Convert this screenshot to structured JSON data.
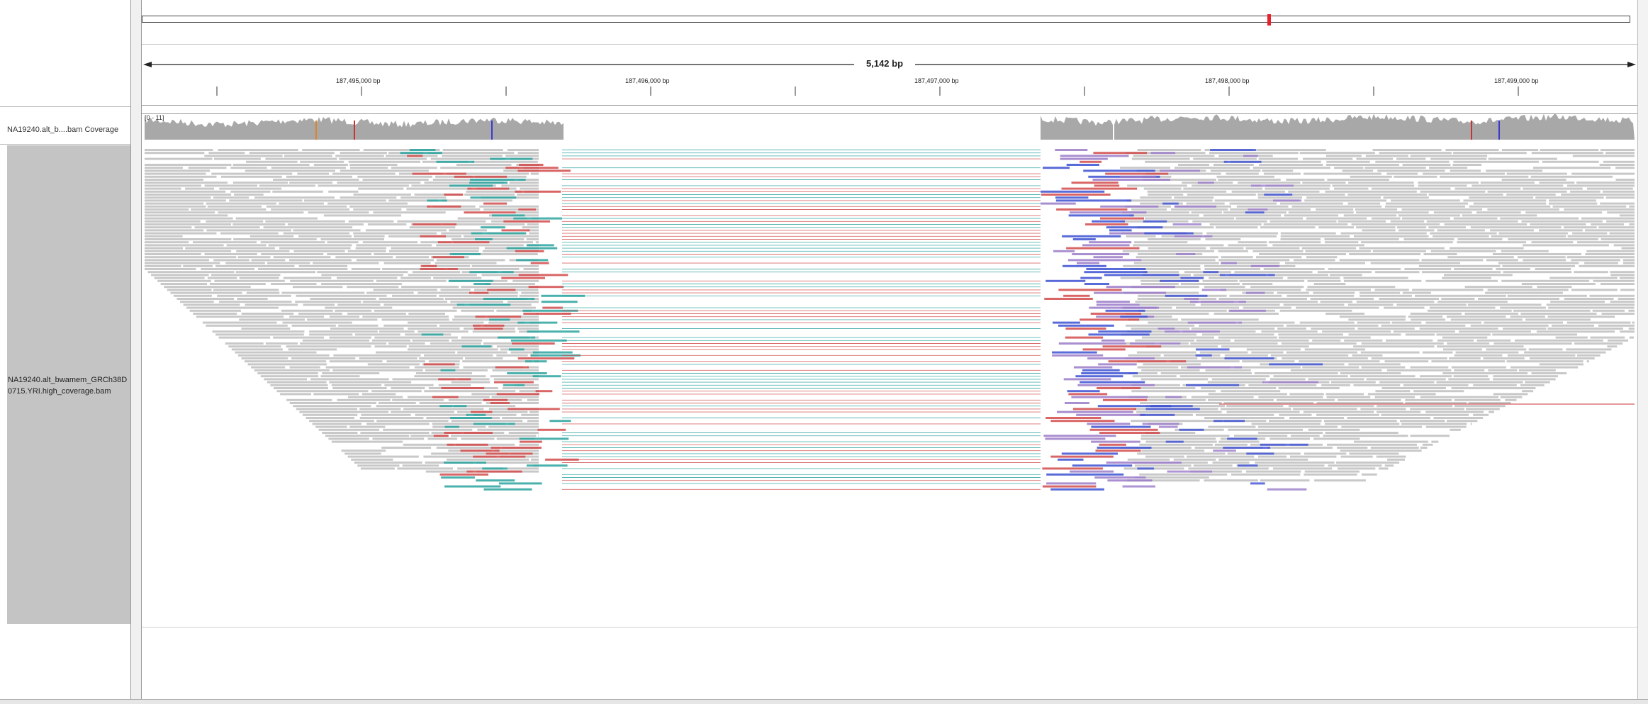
{
  "header": {
    "span_label": "5,142 bp",
    "ruler": [
      {
        "label": "187,495,000 bp",
        "pos": 187495000
      },
      {
        "label": "187,496,000 bp",
        "pos": 187496000
      },
      {
        "label": "187,497,000 bp",
        "pos": 187497000
      },
      {
        "label": "187,498,000 bp",
        "pos": 187498000
      },
      {
        "label": "187,499,000 bp",
        "pos": 187499000
      }
    ]
  },
  "tracks": {
    "coverage": {
      "name": "NA19240.alt_b....bam Coverage",
      "range": "[0 - 11]"
    },
    "alignment": {
      "name_line1": "NA19240.alt_bwamem_GRCh38D",
      "name_line2": "0715.YRI.high_coverage.bam"
    }
  },
  "colors": {
    "read_default": "#c8c8c8",
    "deletion_pair": "#d24b4b",
    "inversion_teal": "#2aa39f",
    "inversion_blue": "#3c50d2",
    "inversion_purple": "#9a7ac8",
    "ideogram_marker": "#e8202a",
    "coverage_fill": "#a8a8a8"
  }
}
